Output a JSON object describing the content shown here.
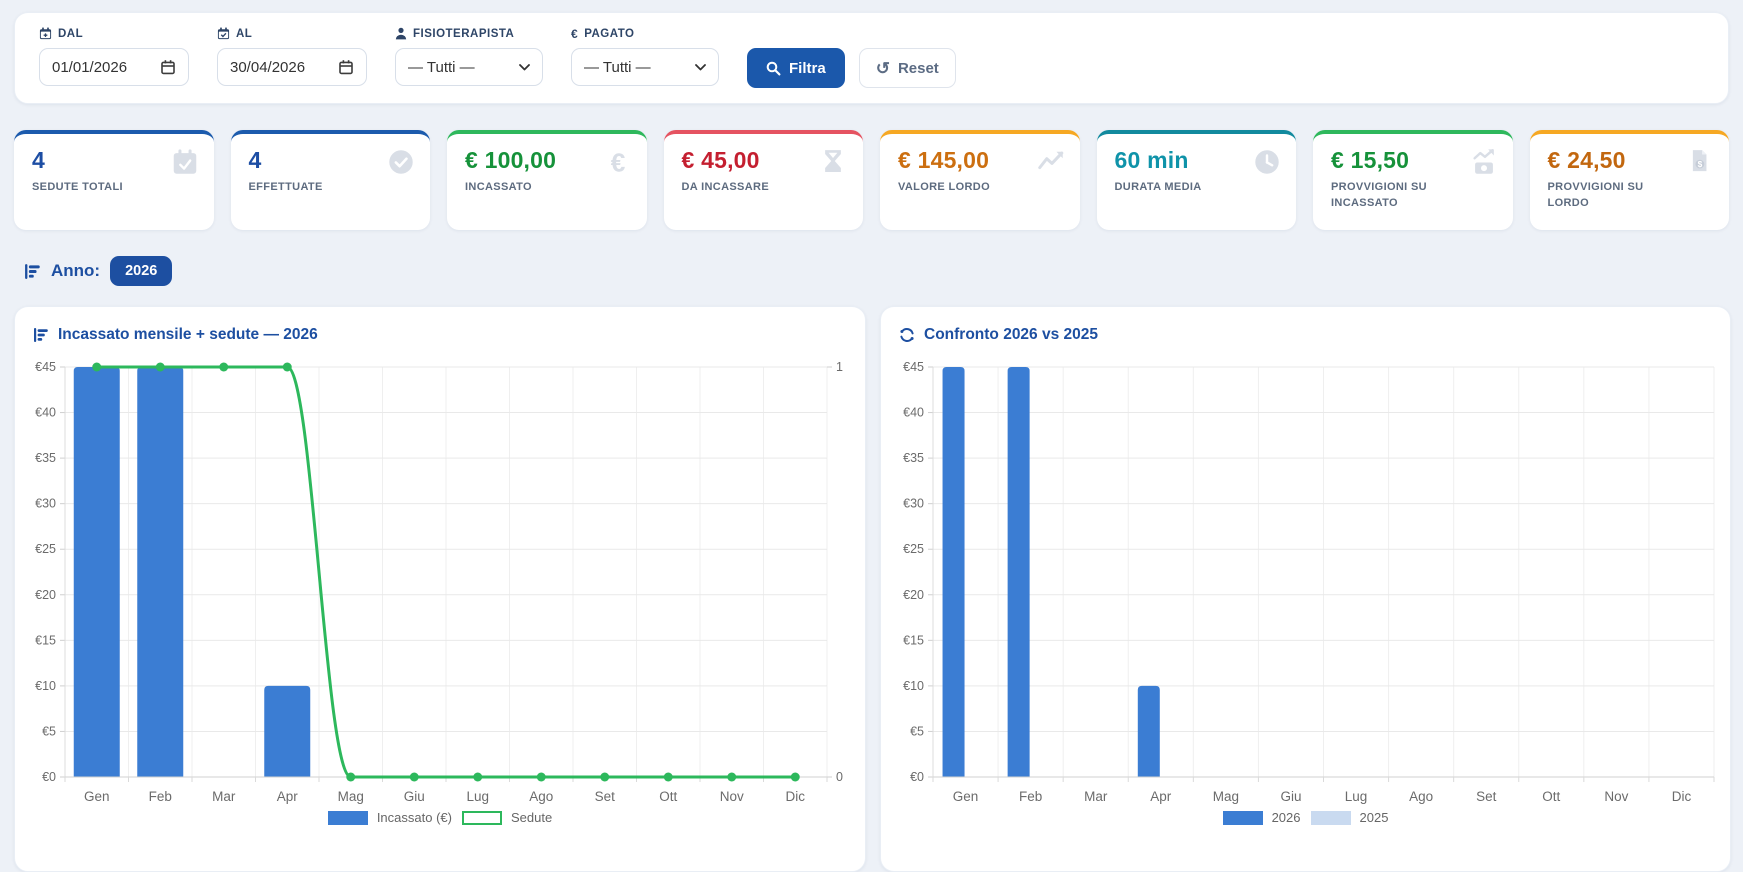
{
  "filters": {
    "dal": {
      "label": "DAL",
      "value": "01/01/2026"
    },
    "al": {
      "label": "AL",
      "value": "30/04/2026"
    },
    "fisioterapista": {
      "label": "FISIOTERAPISTA",
      "value": "— Tutti —"
    },
    "pagato": {
      "label": "PAGATO",
      "value": "— Tutti —"
    },
    "pagato_glyph": "€",
    "filtra_label": "Filtra",
    "reset_label": "Reset"
  },
  "stats": [
    {
      "value": "4",
      "label": "SEDUTE TOTALI",
      "icon": "calendar-check-icon",
      "accent": "#1c5bad",
      "value_color": "#1d4ea4"
    },
    {
      "value": "4",
      "label": "EFFETTUATE",
      "icon": "check-circle-icon",
      "accent": "#1c5bad",
      "value_color": "#1d4ea4"
    },
    {
      "value": "€ 100,00",
      "label": "INCASSATO",
      "icon": "euro-icon",
      "accent": "#2eb85c",
      "value_color": "#16923a"
    },
    {
      "value": "€ 45,00",
      "label": "DA INCASSARE",
      "icon": "hourglass-icon",
      "accent": "#e55361",
      "value_color": "#c41f30"
    },
    {
      "value": "€ 145,00",
      "label": "VALORE LORDO",
      "icon": "chart-line-icon",
      "accent": "#f6a823",
      "value_color": "#cc6f10"
    },
    {
      "value": "60 min",
      "label": "DURATA MEDIA",
      "icon": "clock-icon",
      "accent": "#128a9e",
      "value_color": "#0f93a9"
    },
    {
      "value": "€ 15,50",
      "label": "PROVVIGIONI SU INCASSATO",
      "icon": "money-chart-icon",
      "accent": "#2eb85c",
      "value_color": "#16923a"
    },
    {
      "value": "€ 24,50",
      "label": "PROVVIGIONI SU LORDO",
      "icon": "receipt-icon",
      "accent": "#f6a823",
      "value_color": "#c2670f"
    }
  ],
  "anno": {
    "label": "Anno:",
    "selected": "2026"
  },
  "chart_data": [
    {
      "type": "bar",
      "title": "Incassato mensile + sedute — 2026",
      "categories": [
        "Gen",
        "Feb",
        "Mar",
        "Apr",
        "Mag",
        "Giu",
        "Lug",
        "Ago",
        "Set",
        "Ott",
        "Nov",
        "Dic"
      ],
      "series": [
        {
          "name": "Incassato (€)",
          "type": "bar",
          "values": [
            45,
            45,
            0,
            10,
            0,
            0,
            0,
            0,
            0,
            0,
            0,
            0
          ],
          "color": "#3b7dd3",
          "yaxis": "left"
        },
        {
          "name": "Sedute",
          "type": "line",
          "values": [
            1,
            1,
            1,
            1,
            0,
            0,
            0,
            0,
            0,
            0,
            0,
            0
          ],
          "color": "#2db85c",
          "yaxis": "right"
        }
      ],
      "left_axis": {
        "min": 0,
        "max": 45,
        "step": 5,
        "prefix": "€"
      },
      "right_axis": {
        "min": 0,
        "max": 1,
        "ticks": [
          0,
          1
        ]
      },
      "grid": true,
      "legend_position": "bottom"
    },
    {
      "type": "bar",
      "title": "Confronto 2026 vs 2025",
      "categories": [
        "Gen",
        "Feb",
        "Mar",
        "Apr",
        "Mag",
        "Giu",
        "Lug",
        "Ago",
        "Set",
        "Ott",
        "Nov",
        "Dic"
      ],
      "series": [
        {
          "name": "2026",
          "type": "bar",
          "values": [
            45,
            45,
            0,
            10,
            0,
            0,
            0,
            0,
            0,
            0,
            0,
            0
          ],
          "color": "#3b7dd3"
        },
        {
          "name": "2025",
          "type": "bar",
          "values": [
            0,
            0,
            0,
            0,
            0,
            0,
            0,
            0,
            0,
            0,
            0,
            0
          ],
          "color": "#c9daf0"
        }
      ],
      "left_axis": {
        "min": 0,
        "max": 45,
        "step": 5,
        "prefix": "€"
      },
      "grid": true,
      "legend_position": "bottom"
    }
  ],
  "colors": {
    "accent_blue": "#1b58ab",
    "title_blue": "#1d4fa1",
    "page_bg": "#edf1f7",
    "bar_blue": "#3b7dd3",
    "bar_light_blue": "#c9daf0",
    "line_green": "#2db85c"
  }
}
